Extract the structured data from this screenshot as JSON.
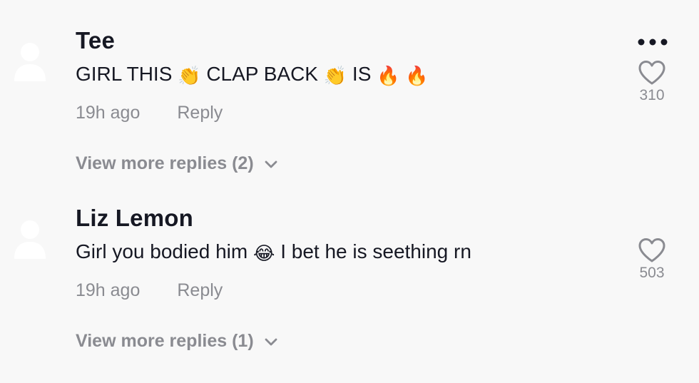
{
  "comments": [
    {
      "username": "Tee",
      "text_parts": [
        "GIRL THIS",
        "👏",
        "CLAP BACK",
        "👏",
        "IS",
        "🔥",
        "🔥"
      ],
      "time": "19h ago",
      "reply_label": "Reply",
      "likes": "310",
      "more_replies": "View more replies (2)"
    },
    {
      "username": "Liz Lemon",
      "text_parts": [
        "Girl you bodied him",
        "😂",
        "I bet he is seething rn"
      ],
      "time": "19h ago",
      "reply_label": "Reply",
      "likes": "503",
      "more_replies": "View more replies (1)"
    }
  ],
  "icons": {
    "options": "more-options-icon",
    "like": "heart-outline-icon",
    "expand": "chevron-down-icon",
    "avatar": "default-avatar-icon"
  },
  "colors": {
    "background": "#f8f8f8",
    "primary_text": "#161823",
    "secondary_text": "#8a8b91",
    "avatar": "#ffffff"
  }
}
